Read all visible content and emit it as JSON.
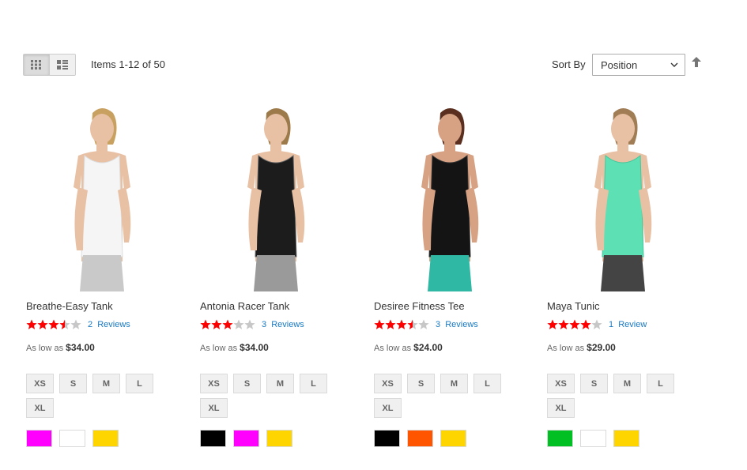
{
  "toolbar": {
    "amount_text": "Items 1-12 of 50",
    "sort_label": "Sort By",
    "sort_value": "Position"
  },
  "products": [
    {
      "name": "Breathe-Easy Tank",
      "rating": 3.5,
      "reviews": "2  Reviews",
      "price_prefix": "As low as",
      "price": "$34.00",
      "sizes": [
        "XS",
        "S",
        "M",
        "L",
        "XL"
      ],
      "colors": [
        "#ff00ff",
        "#ffffff",
        "#ffd500"
      ]
    },
    {
      "name": "Antonia Racer Tank",
      "rating": 3,
      "reviews": "3  Reviews",
      "price_prefix": "As low as",
      "price": "$34.00",
      "sizes": [
        "XS",
        "S",
        "M",
        "L",
        "XL"
      ],
      "colors": [
        "#000000",
        "#ff00ff",
        "#ffd500"
      ]
    },
    {
      "name": "Desiree Fitness Tee",
      "rating": 3.5,
      "reviews": "3  Reviews",
      "price_prefix": "As low as",
      "price": "$24.00",
      "sizes": [
        "XS",
        "S",
        "M",
        "L",
        "XL"
      ],
      "colors": [
        "#000000",
        "#ff5501",
        "#ffd500"
      ]
    },
    {
      "name": "Maya Tunic",
      "rating": 4,
      "reviews": "1  Review",
      "price_prefix": "As low as",
      "price": "$29.00",
      "sizes": [
        "XS",
        "S",
        "M",
        "L",
        "XL"
      ],
      "colors": [
        "#00c023",
        "#ffffff",
        "#ffd500"
      ]
    }
  ]
}
